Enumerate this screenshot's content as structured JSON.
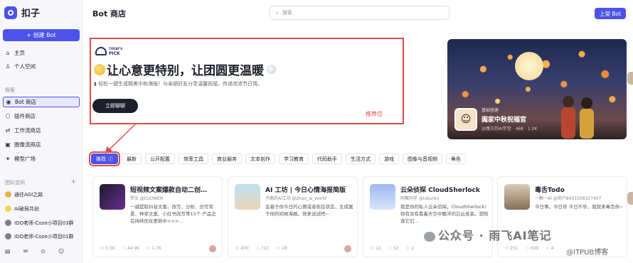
{
  "app": {
    "name": "扣子",
    "create_label": "+ 创建 Bot"
  },
  "nav": {
    "home": "主页",
    "personal": "个人空间",
    "explore_label": "探索",
    "explore_items": [
      "Bot 商店",
      "插件商店",
      "工作流商店",
      "图像流商店",
      "模型广场"
    ],
    "team_label": "团队空间",
    "teams": [
      "通往AGI之路",
      "AI破局共创",
      "IDO老师-Coze小项目03群",
      "IDO老师-Coze小项目01群"
    ]
  },
  "header": {
    "title": "Bot 商店",
    "search_placeholder": "搜索",
    "publish_label": "上架 Bot"
  },
  "banner": {
    "pick_line1": "TODAY'S",
    "pick_line2": "PICK",
    "title": "让心意更特别，让团圆更温暖",
    "subtitle": "轻松一键生成精美中秋海报！与亲朋好友分享温馨祝福，传递浓浓节日情。",
    "cta": "立即聊聊",
    "annotation": "推荐位"
  },
  "promo": {
    "tag": "基础搭建",
    "title": "阖家中秋祝福官",
    "sub": "@魔方的AI学堂  ·  46K  ·  1.0K"
  },
  "tabs": [
    "推荐",
    "最新",
    "公开配置",
    "效率工具",
    "商业服务",
    "文本创作",
    "学习教育",
    "代码助手",
    "生活方式",
    "游戏",
    "图像与音视频",
    "角色"
  ],
  "cards": [
    {
      "title": "短视频文案爆款自动二创…",
      "author": "罗文 @LUOWEN",
      "desc": "一键提取抖音文案、改写、分析、仿写背景、种草文案、小红书改写等15个 产品正在持续优化更新中>>>…",
      "stats": [
        "5.5K",
        "44.9K",
        "1.7K"
      ],
      "right": ""
    },
    {
      "title": "AI 工坊 | 今日心情海报简版",
      "author": "子鹿的AI工坊 @zhao_ai_world",
      "desc": "会基于你今日的心情或者现在状态，生成属于你的间候海报。快来试试吧~",
      "stats": [
        "400",
        "71C",
        "28"
      ],
      "right": ""
    },
    {
      "title": "云朵侦探 CloudSherlock",
      "author": "阿聚同学 @lukuron",
      "desc": "我是你的私人云朵侦探，CloudSherlock! 你有没有看着天空中飘浮的白云发呆。想知道它们…",
      "stats": [
        "12",
        "52",
        "2"
      ],
      "right": "公众号 · 雨飞AI笔记"
    },
    {
      "title": "毒舌Todo",
      "author": "一颗一AI @用户8431558327407",
      "desc": "今日事，今日毕 今日不毕，我就来毒舌你~",
      "stats": [
        "251",
        "699",
        "4"
      ],
      "right": ""
    }
  ],
  "watermark": {
    "main": "公众号 · 雨飞AI笔记",
    "sub": "@ITPUB博客"
  },
  "icons": {
    "search": "search-icon",
    "home": "home-icon",
    "user": "user-icon",
    "bot": "bot-icon",
    "plugin": "plugin-icon",
    "workflow": "workflow-icon",
    "image": "image-icon",
    "model": "model-icon"
  },
  "colors": {
    "accent": "#4d53e8",
    "annotation": "#e34a4a"
  }
}
